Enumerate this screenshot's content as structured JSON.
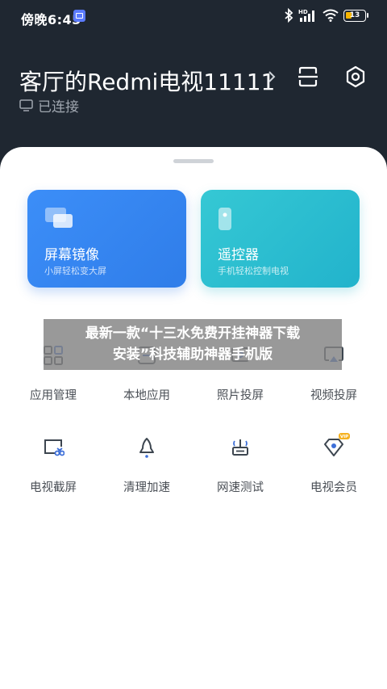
{
  "status_bar": {
    "time": "傍晚6:45",
    "battery": "13",
    "icons": [
      "app-notification-icon",
      "bluetooth-icon",
      "signal-hd-icon",
      "wifi-icon",
      "battery-icon"
    ]
  },
  "header": {
    "device_name": "客厅的Redmi电视11111",
    "connection_status": "已连接",
    "icons": [
      "chevron-right-icon",
      "scan-icon",
      "settings-icon",
      "tv-icon"
    ]
  },
  "cards": [
    {
      "title": "屏幕镜像",
      "subtitle": "小屏轻松变大屏",
      "icon": "screen-mirror-icon",
      "color": "#3c8ef8"
    },
    {
      "title": "遥控器",
      "subtitle": "手机轻松控制电视",
      "icon": "remote-icon",
      "color": "#35c8d4"
    }
  ],
  "grid": [
    {
      "label": "应用管理",
      "icon": "apps-grid-icon"
    },
    {
      "label": "本地应用",
      "icon": "local-app-icon"
    },
    {
      "label": "照片投屏",
      "icon": "photo-cast-icon"
    },
    {
      "label": "视频投屏",
      "icon": "video-cast-icon"
    },
    {
      "label": "电视截屏",
      "icon": "tv-screenshot-icon"
    },
    {
      "label": "清理加速",
      "icon": "rocket-icon"
    },
    {
      "label": "网速测试",
      "icon": "router-icon"
    },
    {
      "label": "电视会员",
      "icon": "vip-diamond-icon",
      "badge": "VIP"
    }
  ],
  "overlay": {
    "line1": "最新一款“十三水免费开挂神器下载",
    "line2": "安装”科技辅助神器手机版"
  },
  "colors": {
    "header_bg": "#1f2731",
    "accent_blue": "#3c8ef8",
    "accent_cyan": "#35c8d4",
    "icon_blue": "#3d6fd8"
  }
}
